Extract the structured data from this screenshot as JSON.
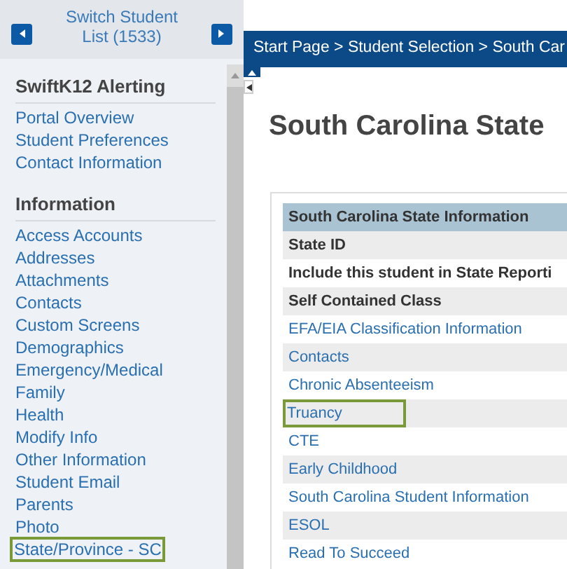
{
  "sidebar": {
    "switcher": {
      "title": "Switch Student",
      "count": "List (1533)"
    },
    "sections": [
      {
        "heading": "SwiftK12 Alerting",
        "items": [
          {
            "label": "Portal Overview",
            "selected": false
          },
          {
            "label": "Student Preferences",
            "selected": false
          },
          {
            "label": "Contact Information",
            "selected": false
          }
        ]
      },
      {
        "heading": "Information",
        "items": [
          {
            "label": "Access Accounts",
            "selected": false
          },
          {
            "label": "Addresses",
            "selected": false
          },
          {
            "label": "Attachments",
            "selected": false
          },
          {
            "label": "Contacts",
            "selected": false
          },
          {
            "label": "Custom Screens",
            "selected": false
          },
          {
            "label": "Demographics",
            "selected": false
          },
          {
            "label": "Emergency/Medical",
            "selected": false
          },
          {
            "label": "Family",
            "selected": false
          },
          {
            "label": "Health",
            "selected": false
          },
          {
            "label": "Modify Info",
            "selected": false
          },
          {
            "label": "Other Information",
            "selected": false
          },
          {
            "label": "Student Email",
            "selected": false
          },
          {
            "label": "Parents",
            "selected": false
          },
          {
            "label": "Photo",
            "selected": false
          },
          {
            "label": "State/Province - SC",
            "selected": true
          }
        ]
      }
    ]
  },
  "breadcrumb": "Start Page > Student Selection > South Car",
  "page_title": "South Carolina State",
  "table": {
    "rows": [
      {
        "kind": "header",
        "text": "South Carolina State Information",
        "selected": false
      },
      {
        "kind": "label",
        "text": "State ID",
        "selected": false
      },
      {
        "kind": "label",
        "text": "Include this student in State Reporti",
        "selected": false
      },
      {
        "kind": "label",
        "text": "Self Contained Class",
        "selected": false
      },
      {
        "kind": "link",
        "text": "EFA/EIA Classification Information",
        "selected": false
      },
      {
        "kind": "link",
        "text": "Contacts",
        "selected": false
      },
      {
        "kind": "link",
        "text": "Chronic Absenteeism",
        "selected": false
      },
      {
        "kind": "link",
        "text": "Truancy",
        "selected": true
      },
      {
        "kind": "link",
        "text": "CTE",
        "selected": false
      },
      {
        "kind": "link",
        "text": "Early Childhood",
        "selected": false
      },
      {
        "kind": "link",
        "text": "South Carolina Student Information",
        "selected": false
      },
      {
        "kind": "link",
        "text": "ESOL",
        "selected": false
      },
      {
        "kind": "link",
        "text": "Read To Succeed",
        "selected": false
      }
    ]
  }
}
